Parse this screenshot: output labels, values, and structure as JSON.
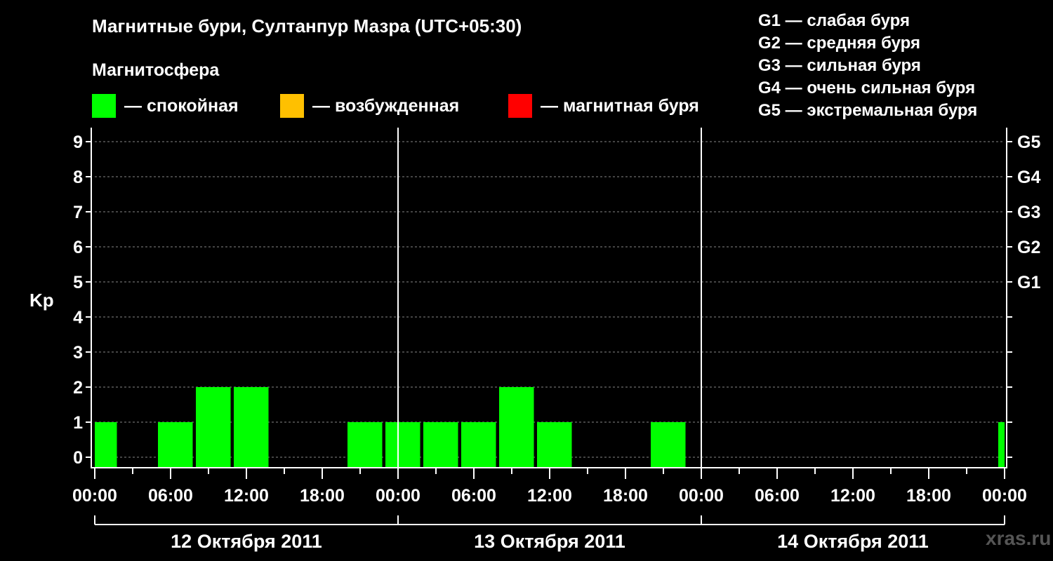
{
  "title": "Магнитные бури, Султанпур Мазра (UTC+05:30)",
  "magnetosphere_label": "Магнитосфера",
  "legend": [
    {
      "color": "#00ff00",
      "label": "— спокойная"
    },
    {
      "color": "#ffc000",
      "label": "— возбужденная"
    },
    {
      "color": "#ff0000",
      "label": "— магнитная буря"
    }
  ],
  "g_legend": [
    "G1 — слабая буря",
    "G2 — средняя буря",
    "G3 — сильная буря",
    "G4 — очень сильная буря",
    "G5 — экстремальная буря"
  ],
  "watermark": "xras.ru",
  "chart_data": {
    "type": "bar",
    "ylabel": "Kp",
    "ylim": [
      0,
      9
    ],
    "yticks": [
      "0",
      "1",
      "2",
      "3",
      "4",
      "5",
      "6",
      "7",
      "8",
      "9"
    ],
    "right_ticks": [
      {
        "kp": 5,
        "label": "G1"
      },
      {
        "kp": 6,
        "label": "G2"
      },
      {
        "kp": 7,
        "label": "G3"
      },
      {
        "kp": 8,
        "label": "G4"
      },
      {
        "kp": 9,
        "label": "G5"
      }
    ],
    "x_tick_labels": [
      "00:00",
      "06:00",
      "12:00",
      "18:00",
      "00:00",
      "06:00",
      "12:00",
      "18:00",
      "00:00",
      "06:00",
      "12:00",
      "18:00",
      "00:00"
    ],
    "days": [
      "12 Октября 2011",
      "13 Октября 2011",
      "14 Октября 2011"
    ],
    "grid": true,
    "bars": [
      {
        "start_hour": 0,
        "end_hour": 1.75,
        "kp": 1,
        "color": "#00ff00"
      },
      {
        "start_hour": 5,
        "end_hour": 7.75,
        "kp": 1,
        "color": "#00ff00"
      },
      {
        "start_hour": 8,
        "end_hour": 10.75,
        "kp": 2,
        "color": "#00ff00"
      },
      {
        "start_hour": 11,
        "end_hour": 13.75,
        "kp": 2,
        "color": "#00ff00"
      },
      {
        "start_hour": 20,
        "end_hour": 22.75,
        "kp": 1,
        "color": "#00ff00"
      },
      {
        "start_hour": 23,
        "end_hour": 25.75,
        "kp": 1,
        "color": "#00ff00"
      },
      {
        "start_hour": 26,
        "end_hour": 28.75,
        "kp": 1,
        "color": "#00ff00"
      },
      {
        "start_hour": 29,
        "end_hour": 31.75,
        "kp": 1,
        "color": "#00ff00"
      },
      {
        "start_hour": 32,
        "end_hour": 34.75,
        "kp": 2,
        "color": "#00ff00"
      },
      {
        "start_hour": 35,
        "end_hour": 37.75,
        "kp": 1,
        "color": "#00ff00"
      },
      {
        "start_hour": 44,
        "end_hour": 46.75,
        "kp": 1,
        "color": "#00ff00"
      },
      {
        "start_hour": 71.5,
        "end_hour": 72,
        "kp": 1,
        "color": "#00ff00"
      }
    ]
  }
}
